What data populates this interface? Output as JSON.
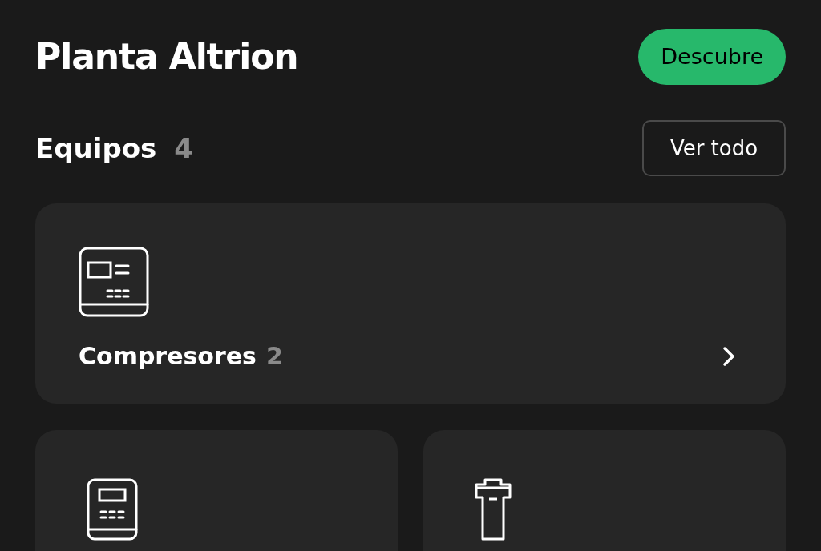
{
  "header": {
    "title": "Planta Altrion",
    "action": "Descubre"
  },
  "section": {
    "title": "Equipos",
    "count": "4",
    "link": "Ver todo"
  },
  "equipment": [
    {
      "kind": "compressor-unit",
      "label": "Compresores",
      "count": "2"
    },
    {
      "kind": "control-panel"
    },
    {
      "kind": "tower"
    }
  ]
}
